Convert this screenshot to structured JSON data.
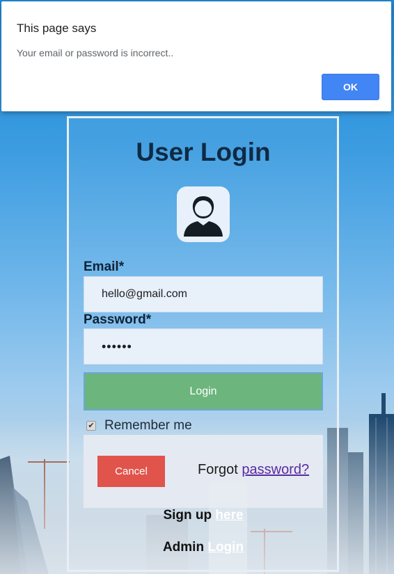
{
  "alert": {
    "title": "This page says",
    "message": "Your email or password is incorrect..",
    "ok_label": "OK"
  },
  "login": {
    "title": "User Login",
    "avatar_icon": "user-avatar-icon",
    "email_label": "Email*",
    "email_value": "hello@gmail.com",
    "password_label": "Password*",
    "password_value": "••••••",
    "login_button": "Login",
    "remember_label": "Remember me",
    "remember_checked": true,
    "cancel_button": "Cancel",
    "forgot_prefix": "Forgot",
    "forgot_link": "password?",
    "signup_prefix": "Sign up",
    "signup_link": "here",
    "admin_prefix": "Admin",
    "admin_link": "Login"
  },
  "colors": {
    "login_button": "#6cb57d",
    "cancel_button": "#e0544c",
    "ok_button": "#4285f4"
  }
}
